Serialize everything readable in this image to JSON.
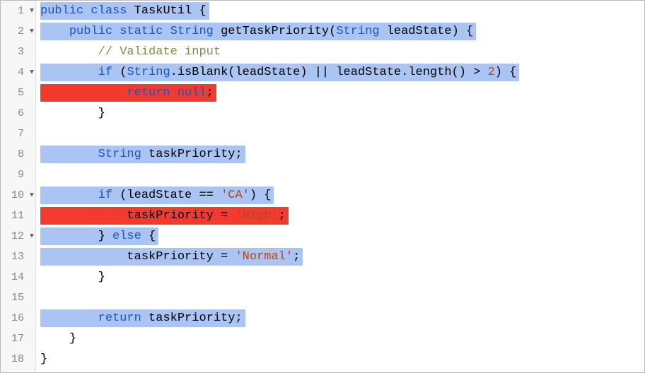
{
  "colors": {
    "highlight_blue": "#aac4f4",
    "highlight_red": "#f23a2f",
    "keyword": "#1a56c4",
    "comment": "#888844",
    "string": "#b04820"
  },
  "lines": [
    {
      "num": 1,
      "fold": true
    },
    {
      "num": 2,
      "fold": true
    },
    {
      "num": 3,
      "fold": false
    },
    {
      "num": 4,
      "fold": true
    },
    {
      "num": 5,
      "fold": false
    },
    {
      "num": 6,
      "fold": false
    },
    {
      "num": 7,
      "fold": false
    },
    {
      "num": 8,
      "fold": false
    },
    {
      "num": 9,
      "fold": false
    },
    {
      "num": 10,
      "fold": true
    },
    {
      "num": 11,
      "fold": false
    },
    {
      "num": 12,
      "fold": true
    },
    {
      "num": 13,
      "fold": false
    },
    {
      "num": 14,
      "fold": false
    },
    {
      "num": 15,
      "fold": false
    },
    {
      "num": 16,
      "fold": false
    },
    {
      "num": 17,
      "fold": false
    },
    {
      "num": 18,
      "fold": false
    }
  ],
  "tokens": {
    "l1": {
      "kw1": "public",
      "kw2": "class",
      "name": "TaskUtil",
      "brace": "{"
    },
    "l2": {
      "indent": "    ",
      "kw1": "public",
      "kw2": "static",
      "type": "String",
      "method": "getTaskPriority",
      "paramType": "String",
      "paramName": "leadState",
      "tail": ") {",
      "open": "("
    },
    "l3": {
      "indent": "        ",
      "comment": "// Validate input"
    },
    "l4": {
      "indent": "        ",
      "kw": "if",
      "open": " (",
      "type": "String",
      "dot": ".",
      "fn": "isBlank",
      "arg": "(leadState)",
      "or": " || ",
      "expr": "leadState.length()",
      "cmp": " > ",
      "num": "2",
      "tail": ") {"
    },
    "l5": {
      "indent": "            ",
      "kw": "return",
      "sp": " ",
      "val": "null",
      "semi": ";"
    },
    "l6": {
      "indent": "        ",
      "brace": "}"
    },
    "l8": {
      "indent": "        ",
      "type": "String",
      "name": " taskPriority;",
      "sp": " "
    },
    "l10": {
      "indent": "        ",
      "kw": "if",
      "open": " (leadState == ",
      "str": "'CA'",
      "tail": ") {"
    },
    "l11": {
      "indent": "            ",
      "lhs": "taskPriority = ",
      "str": "'High'",
      "semi": ";"
    },
    "l12": {
      "indent": "        ",
      "text": "} ",
      "kw": "else",
      "tail": " {"
    },
    "l13": {
      "indent": "            ",
      "lhs": "taskPriority = ",
      "str": "'Normal'",
      "semi": ";"
    },
    "l14": {
      "indent": "        ",
      "brace": "}"
    },
    "l16": {
      "indent": "        ",
      "kw": "return",
      "name": " taskPriority;"
    },
    "l17": {
      "indent": "    ",
      "brace": "}"
    },
    "l18": {
      "brace": "}"
    }
  }
}
